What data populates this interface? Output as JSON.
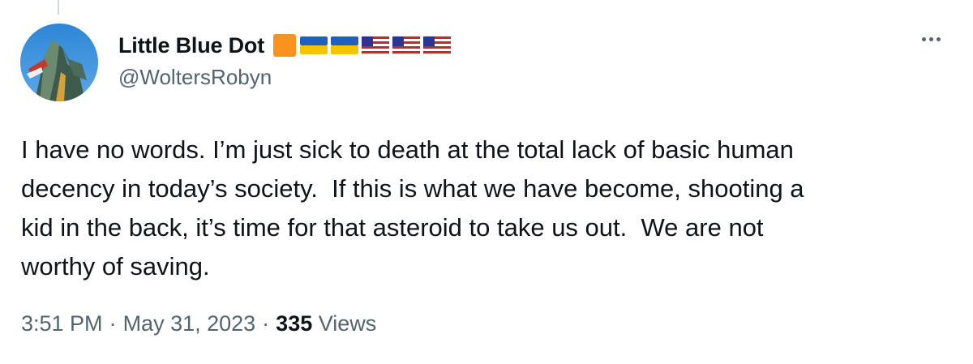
{
  "author": {
    "display_name": "Little Blue Dot",
    "handle": "@WoltersRobyn",
    "emoji_flags": [
      "orange-square-icon",
      "ukraine-flag-icon",
      "ukraine-flag-icon",
      "us-flag-icon",
      "us-flag-icon",
      "us-flag-icon"
    ]
  },
  "tweet": {
    "text": "I have no words. I’m just sick to death at the total lack of basic human\ndecency in today’s society.  If this is what we have become, shooting a\nkid in the back, it’s time for that asteroid to take us out.  We are not\nworthy of saving."
  },
  "meta": {
    "time": "3:51 PM",
    "separator": "·",
    "date": "May 31, 2023",
    "views_count": "335",
    "views_label": "Views"
  },
  "colors": {
    "text_primary": "#0f1419",
    "text_secondary": "#536471",
    "orange_square": "#f7931e",
    "ukraine_blue": "#1f5fbf",
    "ukraine_yellow": "#f5c400"
  }
}
